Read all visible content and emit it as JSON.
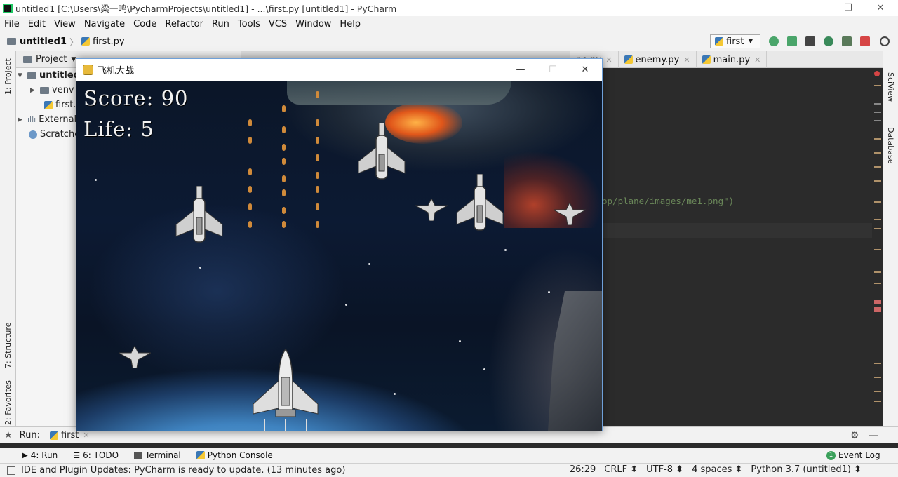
{
  "window": {
    "title": "untitled1 [C:\\Users\\梁一鸣\\PycharmProjects\\untitled1] - ...\\first.py [untitled1] - PyCharm",
    "minimize": "—",
    "maximize": "❐",
    "close": "✕"
  },
  "menu": [
    "File",
    "Edit",
    "View",
    "Navigate",
    "Code",
    "Refactor",
    "Run",
    "Tools",
    "VCS",
    "Window",
    "Help"
  ],
  "breadcrumb": {
    "project": "untitled1",
    "file": "first.py"
  },
  "run_config": "first",
  "left_strip": {
    "project_tab": "1: Project",
    "structure_tab": "7: Structure",
    "favorites_tab": "2: Favorites"
  },
  "project_panel": {
    "header": "Project",
    "tree": [
      {
        "label": "untitled",
        "expanded": true,
        "bold": true
      },
      {
        "label": "venv",
        "expanded": false
      },
      {
        "label": "first.p",
        "expanded": false
      },
      {
        "label": "External",
        "expanded": false
      },
      {
        "label": "Scratche",
        "expanded": false
      }
    ]
  },
  "editor_tabs": [
    {
      "label": "ne.py"
    },
    {
      "label": "enemy.py"
    },
    {
      "label": "main.py"
    }
  ],
  "code_visible": "op/plane/images/me1.png\")",
  "right_strip": {
    "sciview": "SciView",
    "database": "Database"
  },
  "run_bar": {
    "label": "Run:",
    "config": "first"
  },
  "tool_windows": [
    "4: Run",
    "6: TODO",
    "Terminal",
    "Python Console"
  ],
  "event_log": "Event Log",
  "event_log_count": "1",
  "status": {
    "message": "IDE and Plugin Updates: PyCharm is ready to update. (13 minutes ago)",
    "position": "26:29",
    "line_sep": "CRLF ⬍",
    "encoding": "UTF-8 ⬍",
    "indent": "4 spaces ⬍",
    "interpreter": "Python 3.7 (untitled1) ⬍"
  },
  "game": {
    "window_title": "飞机大战",
    "score_text": "Score: 90",
    "life_text": "Life: 5",
    "score": 90,
    "life": 5
  },
  "colors": {
    "accent": "#1fc864",
    "editor_bg": "#2b2b2b",
    "string_green": "#6a8759",
    "bullet": "#d08a3a"
  }
}
